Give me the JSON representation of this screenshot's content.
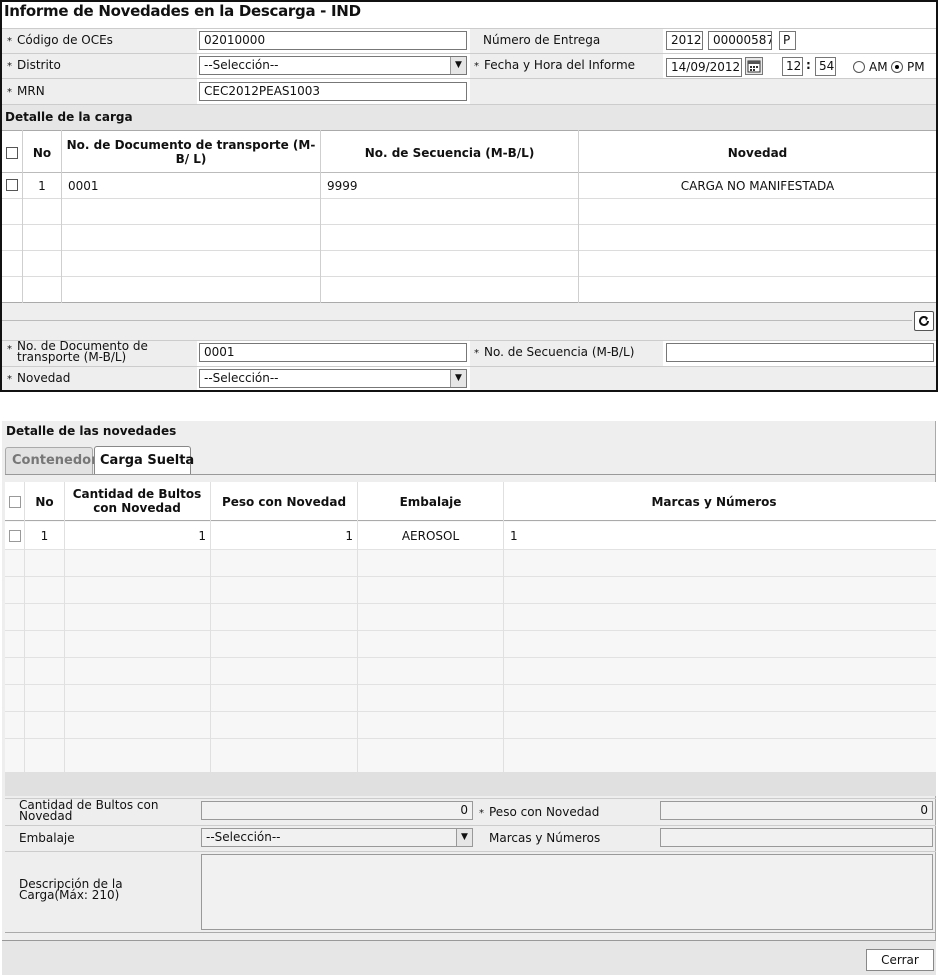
{
  "title": "Informe de Novedades en la Descarga - IND",
  "form": {
    "codigo_label": "Código de OCEs",
    "codigo_value": "02010000",
    "numero_entrega_label": "Número de Entrega",
    "numero_entrega_year": "2012",
    "numero_entrega_num": "00000587",
    "numero_entrega_suffix": "P",
    "distrito_label": "Distrito",
    "distrito_value": "--Selección--",
    "fecha_label": "Fecha y Hora del Informe",
    "fecha_value": "14/09/2012",
    "hora_value": "12",
    "hora_sep": ":",
    "minuto_value": "54",
    "am_label": "AM",
    "pm_label": "PM",
    "mrn_label": "MRN",
    "mrn_value": "CEC2012PEAS1003",
    "required_mark": "*"
  },
  "carga": {
    "section_title": "Detalle de la carga",
    "headers": {
      "no": "No",
      "doc": "No. de Documento de transporte (M-B/ L)",
      "seq": "No. de Secuencia (M-B/L)",
      "novedad": "Novedad"
    },
    "rows": [
      {
        "no": "1",
        "doc": "0001",
        "seq": "9999",
        "novedad": "CARGA NO MANIFESTADA"
      }
    ],
    "doc_label": "No. de Documento de transporte (M-B/L)",
    "doc_value": "0001",
    "seq_label": "No. de Secuencia (M-B/L)",
    "seq_value": "",
    "novedad_label": "Novedad",
    "novedad_value": "--Selección--"
  },
  "novedades": {
    "section_title": "Detalle de las novedades",
    "tabs": [
      "Contenedor",
      "Carga Suelta"
    ],
    "active_tab": "Carga Suelta",
    "headers": {
      "no": "No",
      "bultos": "Cantidad de Bultos con Novedad",
      "peso": "Peso con Novedad",
      "embalaje": "Embalaje",
      "marcas": "Marcas y Números"
    },
    "rows": [
      {
        "no": "1",
        "bultos": "1",
        "peso": "1",
        "embalaje": "AEROSOL",
        "marcas": "1"
      }
    ],
    "bultos_label": "Cantidad de Bultos con Novedad",
    "bultos_value": "0",
    "peso_label": "Peso con Novedad",
    "peso_value": "0",
    "embalaje_label": "Embalaje",
    "embalaje_value": "--Selección--",
    "marcas_label": "Marcas y Números",
    "marcas_value": "",
    "descripcion_label": "Descripción de la Carga(Máx: 210)",
    "descripcion_value": ""
  },
  "footer": {
    "cerrar_label": "Cerrar"
  }
}
